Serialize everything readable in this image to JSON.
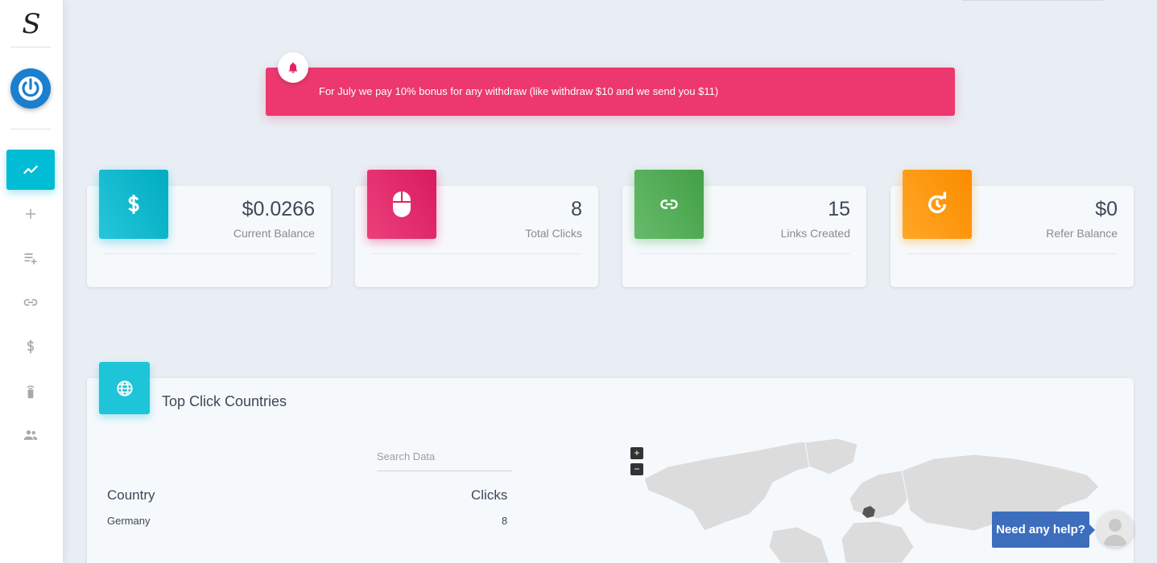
{
  "sidebar": {
    "logo": "S",
    "items": [
      {
        "name": "dashboard",
        "icon": "trending-up-icon",
        "active": true
      },
      {
        "name": "add",
        "icon": "plus-icon"
      },
      {
        "name": "playlist-add",
        "icon": "playlist-add-icon"
      },
      {
        "name": "links",
        "icon": "link-icon"
      },
      {
        "name": "withdraw",
        "icon": "dollar-icon"
      },
      {
        "name": "remote",
        "icon": "remote-icon"
      },
      {
        "name": "referrals",
        "icon": "people-icon"
      }
    ]
  },
  "alert": {
    "text": "For July we pay 10% bonus for any withdraw (like withdraw $10 and we send you $11)",
    "color": "#ec386f"
  },
  "stats": [
    {
      "value": "$0.0266",
      "label": "Current Balance",
      "icon": "dollar-icon",
      "color": "#1ec4d8"
    },
    {
      "value": "8",
      "label": "Total Clicks",
      "icon": "mouse-icon",
      "color": "#e91e63"
    },
    {
      "value": "15",
      "label": "Links Created",
      "icon": "link-icon",
      "color": "#4caf50"
    },
    {
      "value": "$0",
      "label": "Refer Balance",
      "icon": "refresh-icon",
      "color": "#ff9800"
    }
  ],
  "countries": {
    "title": "Top Click Countries",
    "search_placeholder": "Search Data",
    "columns": [
      "Country",
      "Clicks"
    ],
    "rows": [
      {
        "country": "Germany",
        "clicks": "8"
      }
    ],
    "zoom_in": "+",
    "zoom_out": "−"
  },
  "help": {
    "label": "Need any help?"
  }
}
